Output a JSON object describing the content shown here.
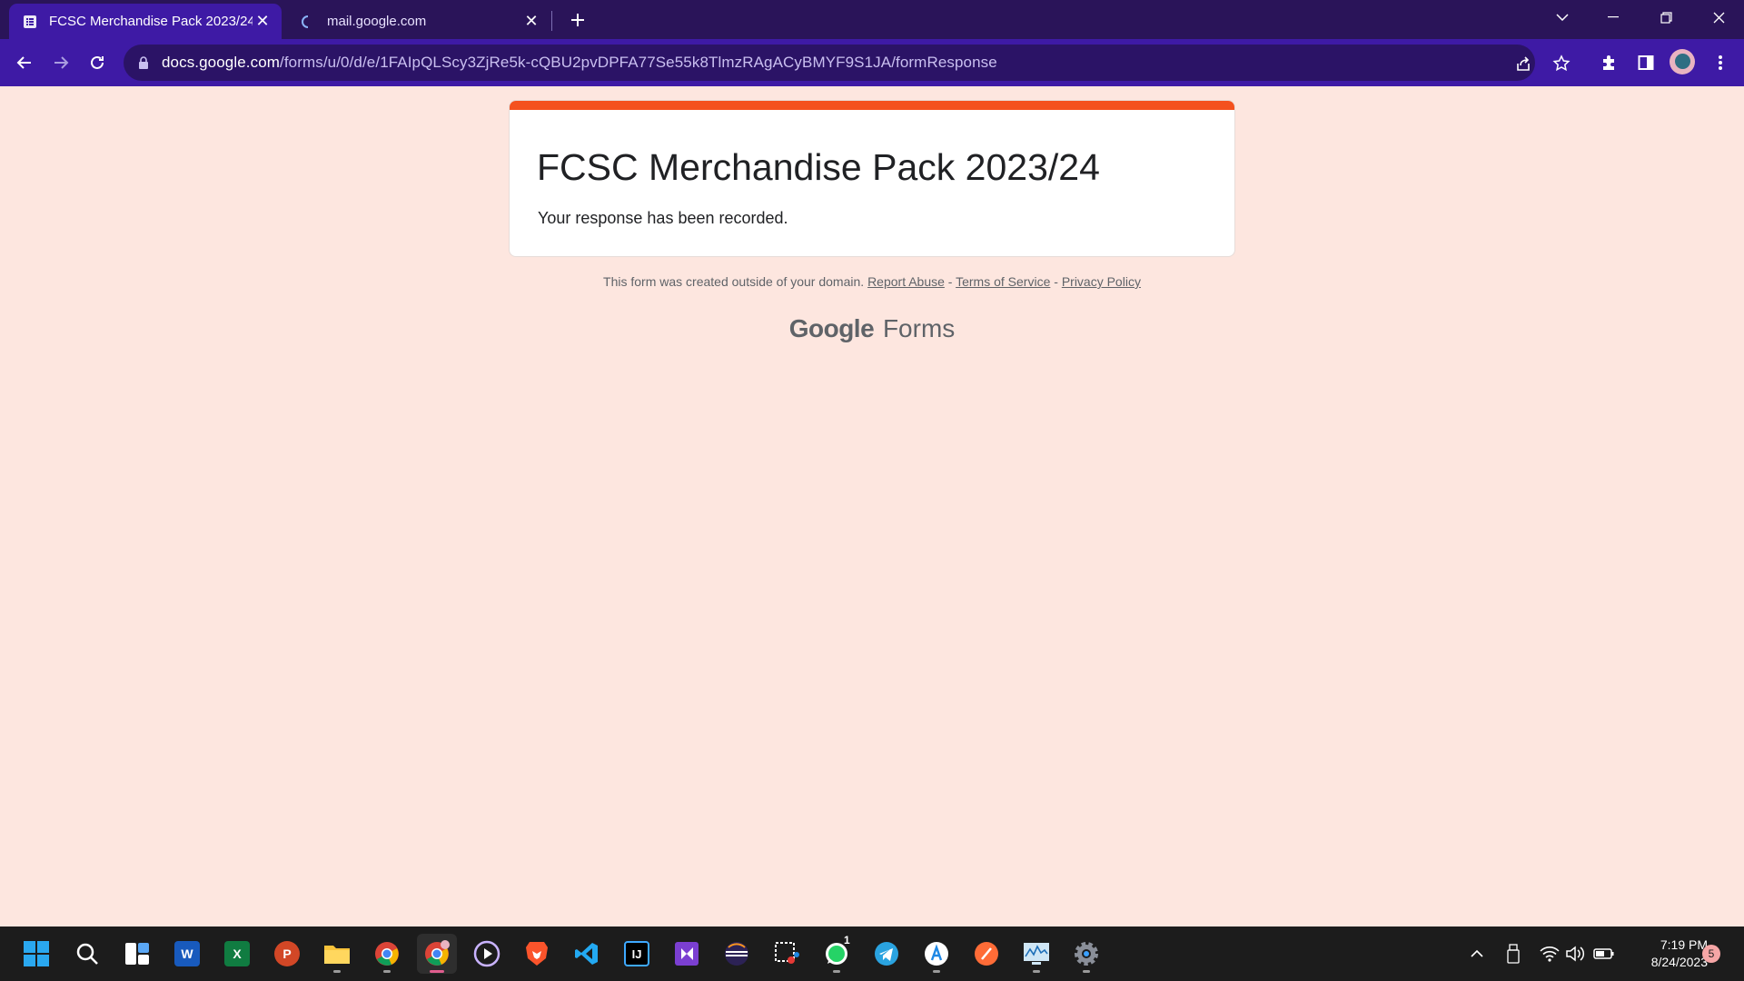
{
  "browser": {
    "tabs": [
      {
        "title": "FCSC Merchandise Pack 2023/24",
        "active": true,
        "favicon": "forms-icon"
      },
      {
        "title": "mail.google.com",
        "active": false,
        "favicon": "loading-spinner-icon"
      }
    ],
    "address": {
      "host": "docs.google.com",
      "path": "/forms/u/0/d/e/1FAIpQLScy3ZjRe5k-cQBU2pvDPFA77Se55k8TlmzRAgACyBMYF9S1JA/formResponse"
    }
  },
  "form": {
    "title": "FCSC Merchandise Pack 2023/24",
    "confirmation": "Your response has been recorded.",
    "accent_color": "#f4511e",
    "page_background": "#fde6df"
  },
  "footer": {
    "note": "This form was created outside of your domain.",
    "report_abuse": "Report Abuse",
    "sep1": " - ",
    "terms": "Terms of Service",
    "sep2": " - ",
    "privacy": "Privacy Policy",
    "brand_google": "Google",
    "brand_forms": "Forms"
  },
  "taskbar": {
    "whatsapp_badge": "1",
    "clock_time": "7:19 PM",
    "clock_date": "8/24/2023",
    "notification_count": "5",
    "word_letter": "W",
    "excel_letter": "X",
    "powerpoint_letter": "P",
    "intellij_letter": "IJ"
  }
}
